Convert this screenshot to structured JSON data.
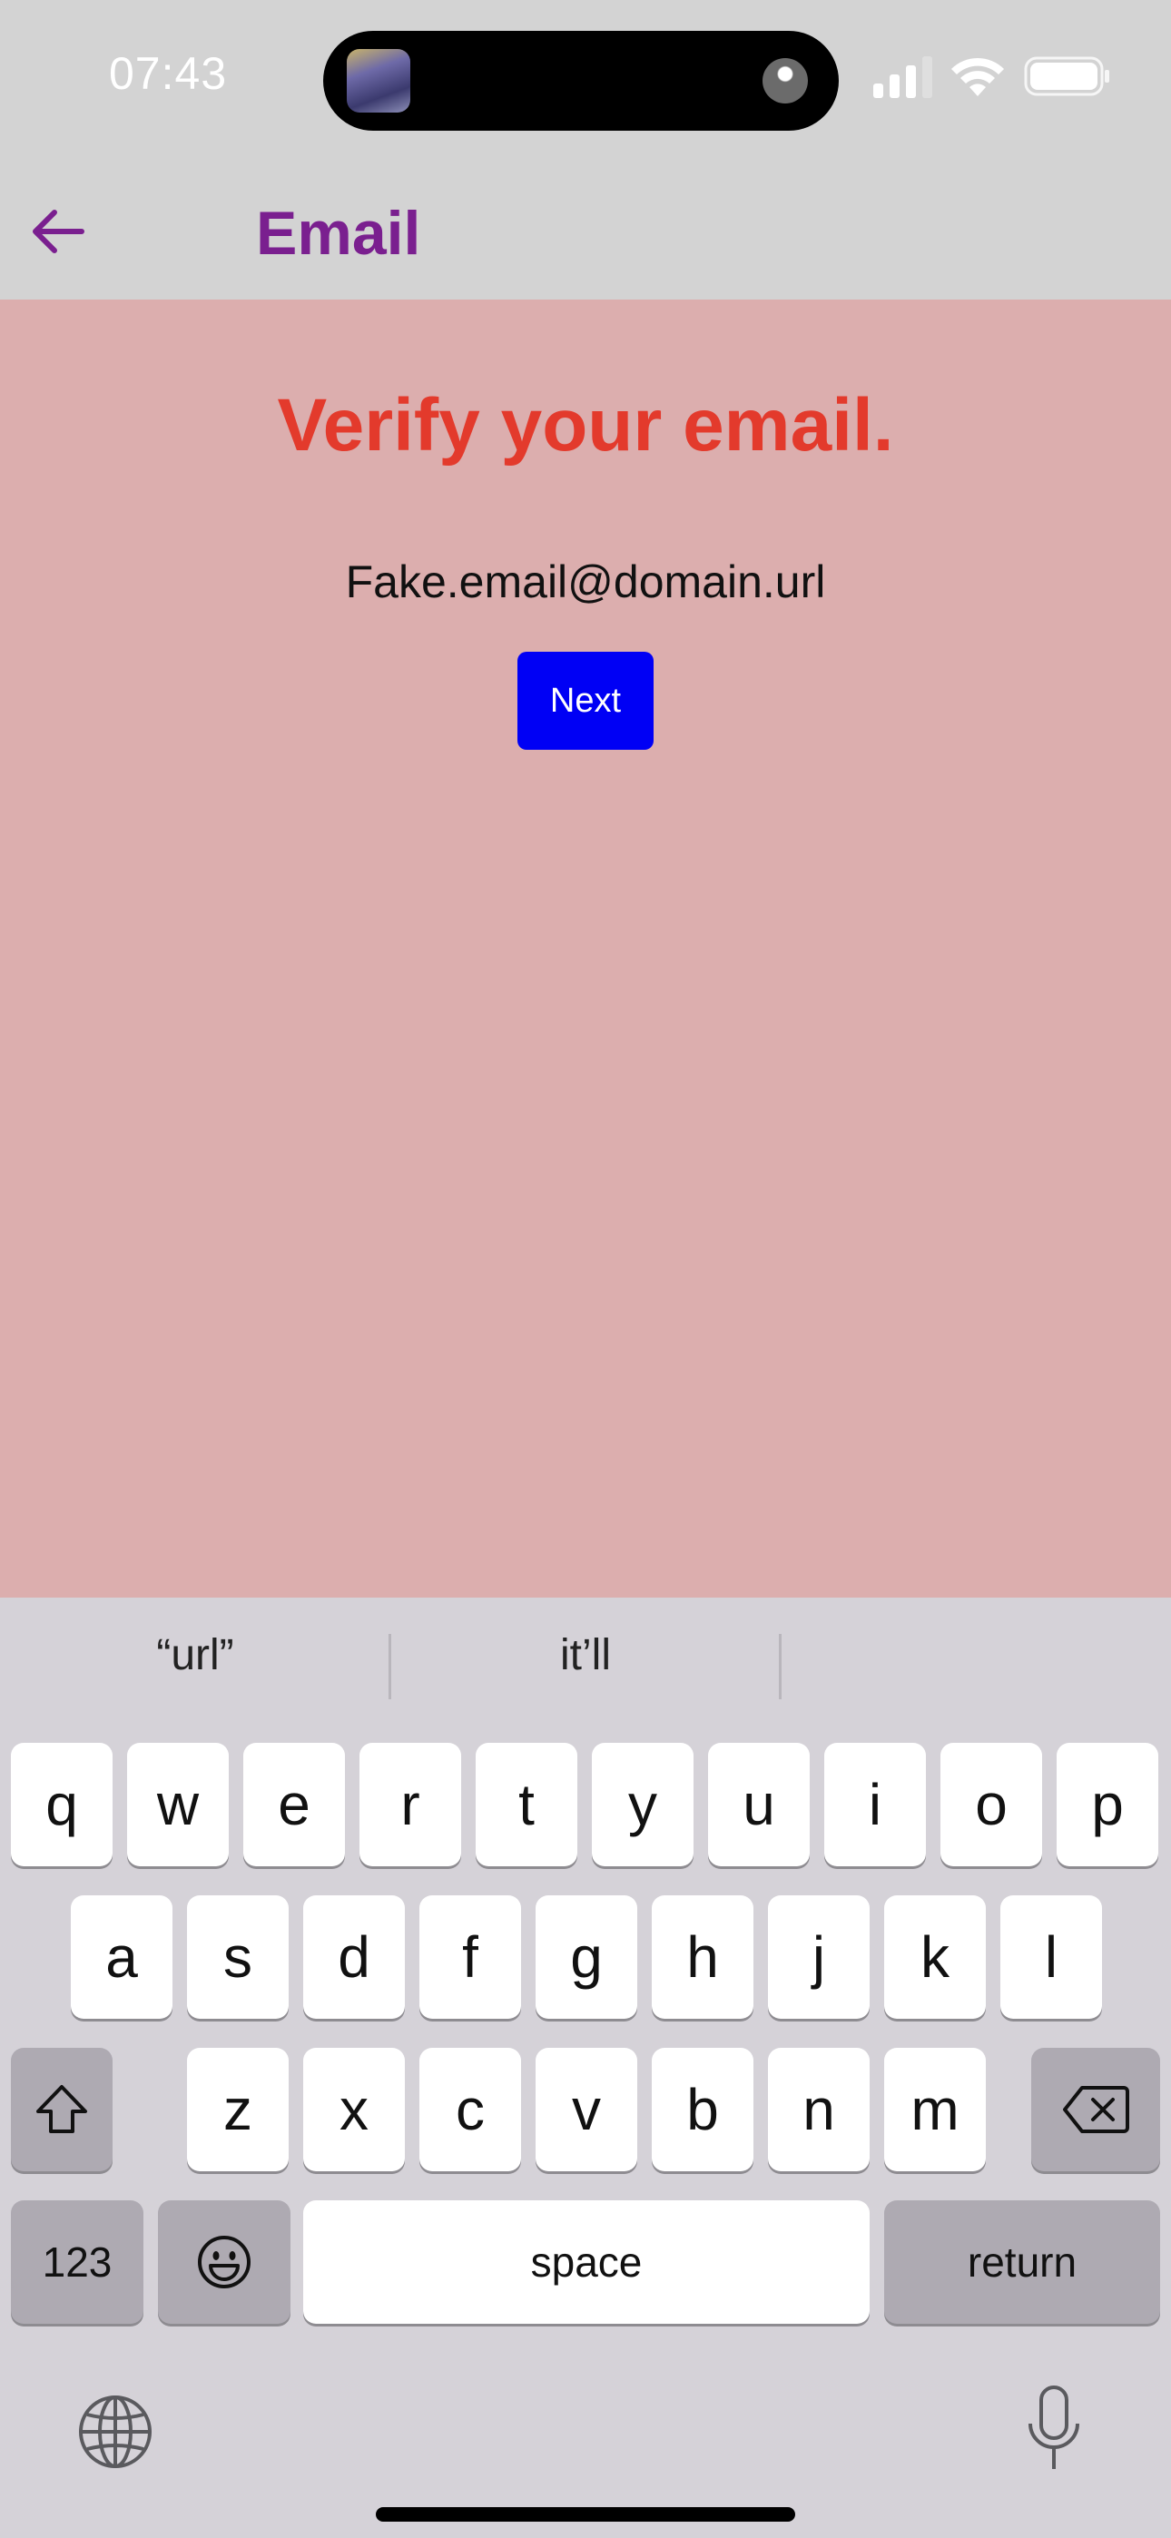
{
  "status_bar": {
    "time": "07:43"
  },
  "nav": {
    "title": "Email"
  },
  "main": {
    "heading": "Verify your email.",
    "email": "Fake.email@domain.url",
    "next_label": "Next"
  },
  "keyboard": {
    "suggestions": [
      "“url”",
      "it’ll",
      ""
    ],
    "row1": [
      "q",
      "w",
      "e",
      "r",
      "t",
      "y",
      "u",
      "i",
      "o",
      "p"
    ],
    "row2": [
      "a",
      "s",
      "d",
      "f",
      "g",
      "h",
      "j",
      "k",
      "l"
    ],
    "row3": [
      "z",
      "x",
      "c",
      "v",
      "b",
      "n",
      "m"
    ],
    "numbers_label": "123",
    "space_label": "space",
    "return_label": "return"
  },
  "colors": {
    "nav_title": "#7a1f8f",
    "heading": "#e33a2c",
    "content_bg": "#dcaeae",
    "next_button": "#0000f5"
  }
}
